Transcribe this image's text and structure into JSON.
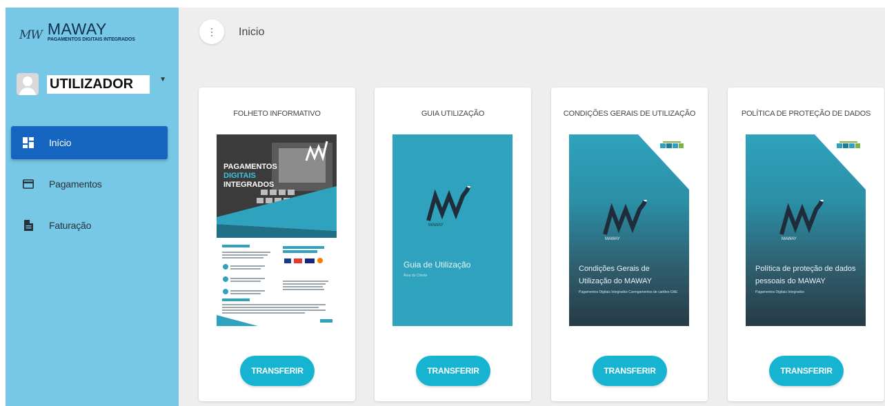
{
  "brand": {
    "mark": "MW",
    "name": "MAWAY",
    "subtitle": "PAGAMENTOS DIGITAIS INTEGRADOS"
  },
  "user": {
    "name": "UTILIZADOR"
  },
  "nav": {
    "items": [
      {
        "label": "Início",
        "icon": "dashboard-icon",
        "active": true
      },
      {
        "label": "Pagamentos",
        "icon": "credit-card-icon",
        "active": false
      },
      {
        "label": "Faturação",
        "icon": "document-icon",
        "active": false
      }
    ]
  },
  "header": {
    "title": "Inicio"
  },
  "cards": [
    {
      "title": "FOLHETO INFORMATIVO",
      "button": "TRANSFERIR",
      "doc": {
        "type": "flyer",
        "heading": "PAGAMENTOS DIGITAIS INTEGRADOS"
      }
    },
    {
      "title": "GUIA UTILIZAÇÃO",
      "button": "TRANSFERIR",
      "doc": {
        "type": "teal",
        "heading": "Guia de Utilização",
        "sub": "Área do Cliente"
      }
    },
    {
      "title": "CONDIÇÕES GERAIS DE UTILIZAÇÃO",
      "button": "TRANSFERIR",
      "doc": {
        "type": "gradient",
        "heading": "Condições Gerais de Utilização do MAWAY",
        "sub": "Pagamentos Digitais Integrados Carregamentos de cartões GAE"
      }
    },
    {
      "title": "POLÍTICA DE PROTEÇÃO DE DADOS",
      "button": "TRANSFERIR",
      "doc": {
        "type": "gradient",
        "heading": "Política de proteção de dados pessoais do MAWAY",
        "sub": "Pagamentos Digitais Integrados"
      }
    }
  ],
  "colors": {
    "sidebar": "#77c7e6",
    "nav_active": "#1565c0",
    "button": "#17b4d1",
    "doc_teal": "#2fa3bd",
    "content_bg": "#eeeeee"
  }
}
